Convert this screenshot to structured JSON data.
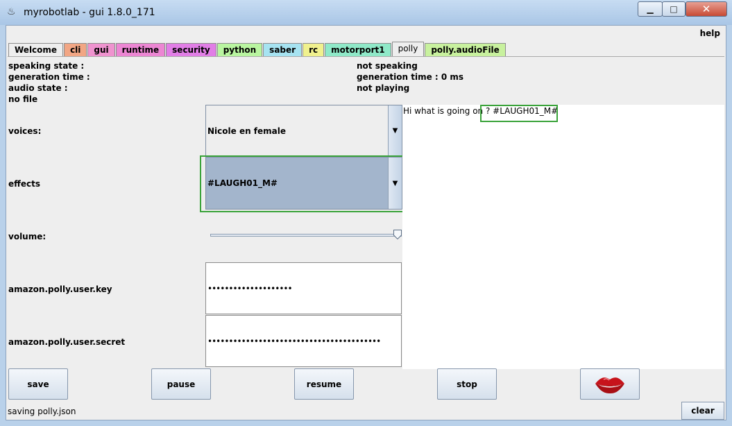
{
  "window": {
    "title": "myrobotlab - gui 1.8.0_171",
    "minimize_glyph": "▁",
    "maximize_glyph": "□",
    "close_glyph": "✕"
  },
  "menu": {
    "help": "help"
  },
  "tabs": [
    {
      "label": "Welcome",
      "color": "#eeeeee",
      "active": false
    },
    {
      "label": "cli",
      "color": "#f2a684",
      "active": false
    },
    {
      "label": "gui",
      "color": "#ef93cf",
      "active": false
    },
    {
      "label": "runtime",
      "color": "#ec86d3",
      "active": false
    },
    {
      "label": "security",
      "color": "#e17ee6",
      "active": false
    },
    {
      "label": "python",
      "color": "#b9f5a0",
      "active": false
    },
    {
      "label": "saber",
      "color": "#a6e3f1",
      "active": false
    },
    {
      "label": "rc",
      "color": "#f0f18e",
      "active": false
    },
    {
      "label": "motorport1",
      "color": "#8fe9c8",
      "active": false
    },
    {
      "label": "polly",
      "color": "#eeeeee",
      "active": true
    },
    {
      "label": "polly.audioFile",
      "color": "#c8f19e",
      "active": false
    }
  ],
  "status_rows": {
    "speaking_state_label": "speaking state :",
    "generation_time_label": "generation time :",
    "audio_state_label": "audio state :",
    "file_label": "no file",
    "speaking_state_value": "not speaking",
    "generation_time_value": "generation time : 0 ms",
    "audio_state_value": "not playing"
  },
  "form": {
    "voices_label": "voices:",
    "voices_value": "Nicole en female",
    "effects_label": "effects",
    "effects_value": "#LAUGH01_M#",
    "volume_label": "volume:",
    "volume_level": 1.0,
    "key_label": "amazon.polly.user.key",
    "key_value": "••••••••••••••••••••",
    "secret_label": "amazon.polly.user.secret",
    "secret_value": "•••••••••••••••••••••••••••••••••••••••••"
  },
  "speech_text": {
    "prefix": "Hi what is going on ? ",
    "effect_tag": "#LAUGH01_M#"
  },
  "buttons": {
    "save": "save",
    "pause": "pause",
    "resume": "resume",
    "stop": "stop",
    "speak_icon": "lips-icon"
  },
  "statusbar": {
    "message": "saving polly.json",
    "clear": "clear"
  },
  "colors": {
    "highlight": "#3aa33a",
    "effects_selected_bg": "#a3b5cc"
  }
}
